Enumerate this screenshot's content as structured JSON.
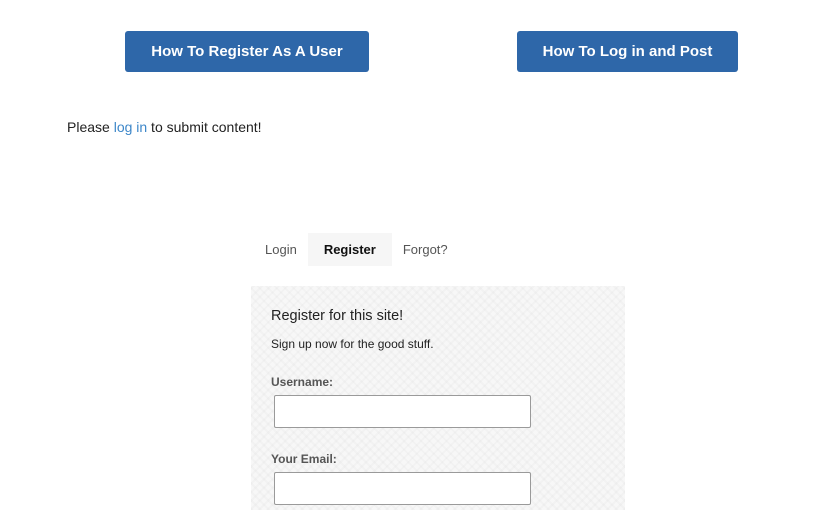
{
  "buttons": {
    "register_help": "How To Register As A User",
    "login_help": "How To Log in and Post"
  },
  "notice": {
    "prefix": "Please ",
    "link": "log in",
    "suffix": " to submit content!"
  },
  "tabs": [
    {
      "label": "Login",
      "active": false
    },
    {
      "label": "Register",
      "active": true
    },
    {
      "label": "Forgot?",
      "active": false
    }
  ],
  "form": {
    "title": "Register for this site!",
    "subtitle": "Sign up now for the good stuff.",
    "username_label": "Username:",
    "username_value": "",
    "email_label": "Your Email:",
    "email_value": ""
  },
  "colors": {
    "button_bg": "#2e67a9",
    "link": "#3d87c9"
  }
}
